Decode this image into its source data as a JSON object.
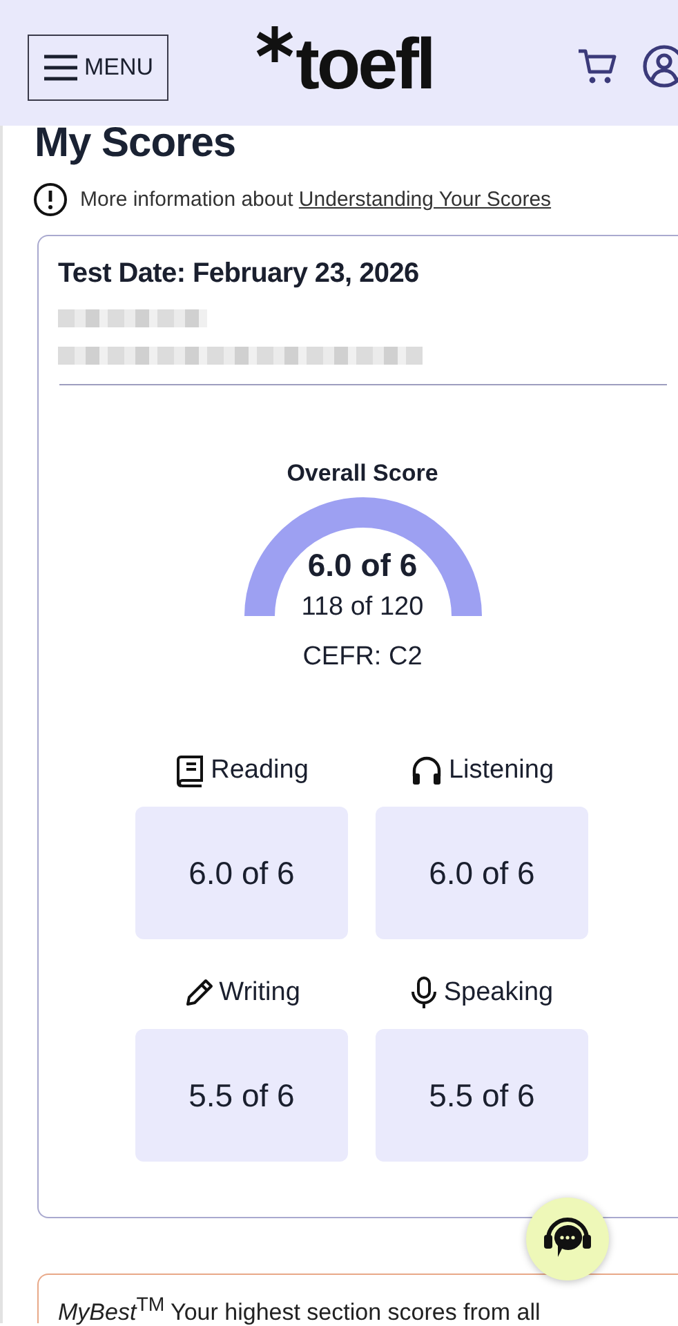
{
  "header": {
    "menu_label": "MENU",
    "logo": "toefl"
  },
  "page_title": "My Scores",
  "info": {
    "text": "More information about",
    "link": "Understanding Your Scores"
  },
  "score_card": {
    "test_date": "Test Date: February 23, 2026",
    "overall": {
      "label": "Overall Score",
      "score": "6.0 of 6",
      "scale_score": "118 of 120",
      "cefr": "CEFR: C2"
    },
    "sections": [
      {
        "name": "Reading",
        "score": "6.0 of 6"
      },
      {
        "name": "Listening",
        "score": "6.0 of 6"
      },
      {
        "name": "Writing",
        "score": "5.5 of 6"
      },
      {
        "name": "Speaking",
        "score": "5.5 of 6"
      }
    ]
  },
  "mybest": {
    "text": "*MyBest*$^{TM}$ Your highest section scores from all"
  }
}
